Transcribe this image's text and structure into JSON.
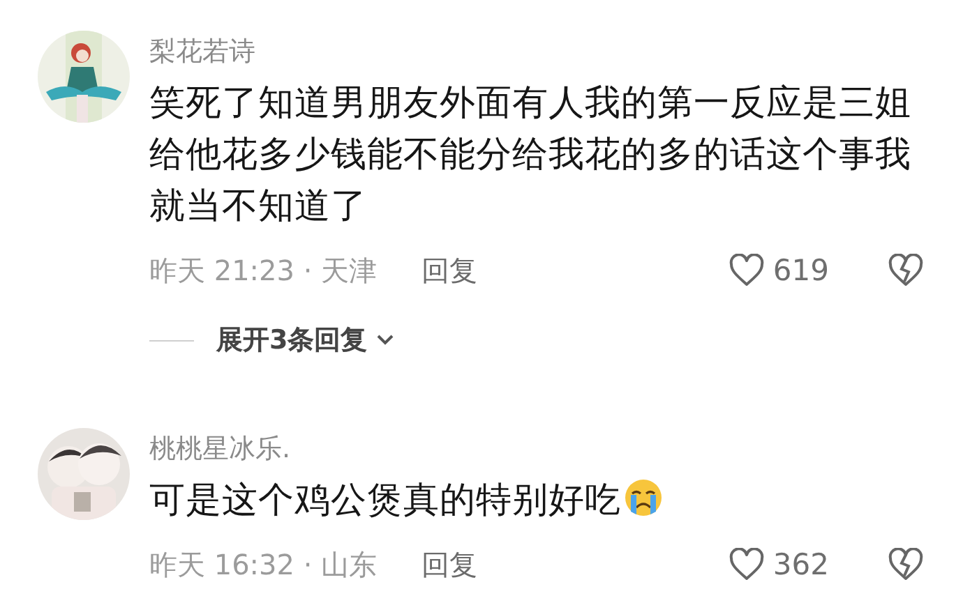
{
  "comments": [
    {
      "author": "梨花若诗",
      "text": "笑死了知道男朋友外面有人我的第一反应是三姐给他花多少钱能不能分给我花的多的话这个事我就当不知道了",
      "emoji": false,
      "meta": "昨天 21:23 · 天津",
      "reply": "回复",
      "likes": "619",
      "expand": "展开3条回复"
    },
    {
      "author": "桃桃星冰乐.",
      "text": "可是这个鸡公煲真的特别好吃",
      "emoji": true,
      "meta": "昨天 16:32 · 山东",
      "reply": "回复",
      "likes": "362"
    }
  ]
}
